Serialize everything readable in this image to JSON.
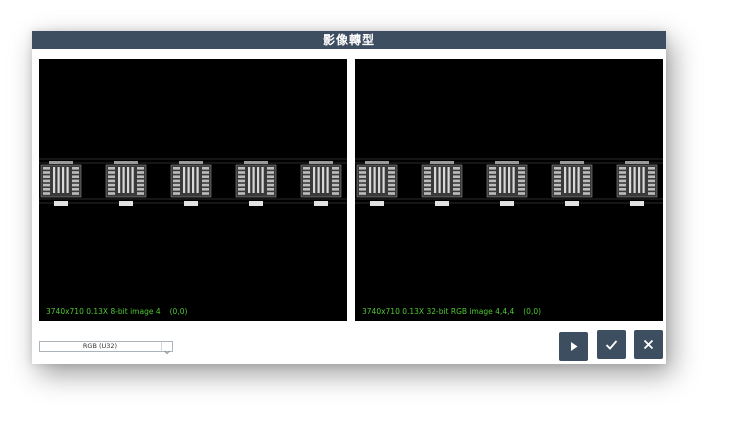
{
  "dialog": {
    "title": "影像轉型"
  },
  "viewers": {
    "source": {
      "status": "3740x710 0.13X 8-bit image 4",
      "coord": "(0,0)"
    },
    "result": {
      "status": "3740x710 0.13X 32-bit RGB image 4,4,4",
      "coord": "(0,0)"
    }
  },
  "format_select": {
    "value": "RGB (U32)"
  },
  "buttons": {
    "run_icon": "play-icon",
    "ok_icon": "check-icon",
    "cancel_icon": "close-icon"
  },
  "colors": {
    "titlebar": "#3d4e60",
    "status_text": "#4ec832",
    "viewer_bg": "#000000"
  }
}
